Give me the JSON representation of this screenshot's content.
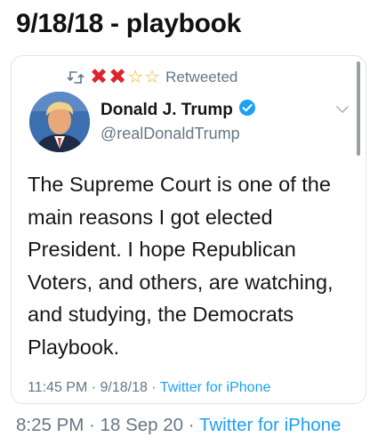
{
  "page_title": "9/18/18 - playbook",
  "tweet": {
    "retweet_status": "Retweeted",
    "retweeter_name": {
      "marks": [
        "✖",
        "✖"
      ],
      "stars": [
        "☆",
        "☆"
      ]
    },
    "author_name": "Donald J. Trump",
    "author_handle": "@realDonaldTrump",
    "text": "The Supreme Court is one of the main reasons I got elected President. I hope Republican Voters, and others, are watching, and studying, the Democrats Playbook.",
    "time": "11:45 PM",
    "date": "9/18/18",
    "source": "Twitter for iPhone"
  },
  "post": {
    "time": "8:25 PM",
    "date": "18 Sep 20",
    "source": "Twitter for iPhone"
  },
  "colors": {
    "link": "#1da1f2",
    "muted": "#657786",
    "verified": "#1da1f2",
    "x_mark": "#e0242b",
    "star": "#f2b01e"
  },
  "icons": {
    "retweet": "retweet-icon",
    "verified": "verified-badge-icon",
    "chevron": "chevron-down-icon"
  }
}
